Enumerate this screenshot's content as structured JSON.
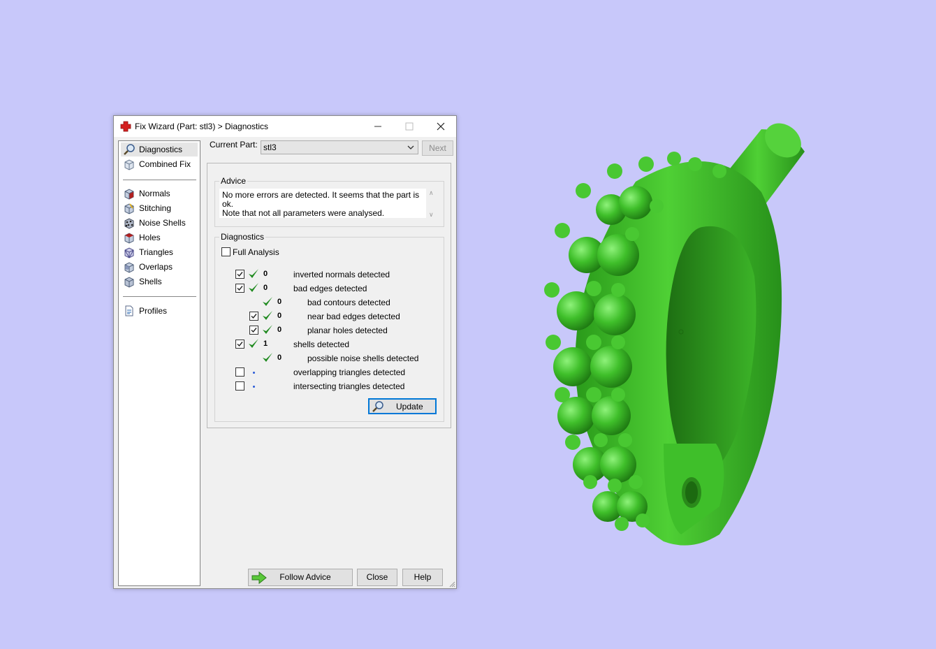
{
  "window": {
    "title": "Fix Wizard (Part: stl3) > Diagnostics",
    "minimize_glyph": "—",
    "maximize_glyph": "☐",
    "close_glyph": "✕"
  },
  "sidebar": {
    "top_items": [
      {
        "label": "Diagnostics",
        "icon": "magnifier-icon",
        "selected": true
      },
      {
        "label": "Combined Fix",
        "icon": "cube-icon"
      }
    ],
    "fix_items": [
      {
        "label": "Normals",
        "icon": "normals-cube-icon"
      },
      {
        "label": "Stitching",
        "icon": "stitching-cube-icon"
      },
      {
        "label": "Noise Shells",
        "icon": "noise-shells-icon"
      },
      {
        "label": "Holes",
        "icon": "holes-cube-icon"
      },
      {
        "label": "Triangles",
        "icon": "triangles-cube-icon"
      },
      {
        "label": "Overlaps",
        "icon": "overlaps-cube-icon"
      },
      {
        "label": "Shells",
        "icon": "shells-cube-icon"
      }
    ],
    "bottom_items": [
      {
        "label": "Profiles",
        "icon": "document-icon"
      }
    ]
  },
  "part": {
    "label": "Current Part:",
    "value": "stl3",
    "next_label": "Next"
  },
  "advice": {
    "title": "Advice",
    "line1": "No more errors are detected. It seems that the part is ok.",
    "line2": "Note that not all parameters were analysed."
  },
  "diagnostics": {
    "title": "Diagnostics",
    "full_analysis_label": "Full Analysis",
    "full_analysis_checked": false,
    "rows": [
      {
        "checkbox": true,
        "checked": true,
        "status": "ok",
        "count": "0",
        "label": "inverted normals detected",
        "indent": 0
      },
      {
        "checkbox": true,
        "checked": true,
        "status": "ok",
        "count": "0",
        "label": "bad edges detected",
        "indent": 0
      },
      {
        "checkbox": false,
        "checked": false,
        "status": "ok",
        "count": "0",
        "label": "bad contours detected",
        "indent": 1
      },
      {
        "checkbox": true,
        "checked": true,
        "status": "ok",
        "count": "0",
        "label": "near bad edges detected",
        "indent": 1
      },
      {
        "checkbox": true,
        "checked": true,
        "status": "ok",
        "count": "0",
        "label": "planar holes detected",
        "indent": 1
      },
      {
        "checkbox": true,
        "checked": true,
        "status": "ok",
        "count": "1",
        "label": "shells detected",
        "indent": 0
      },
      {
        "checkbox": false,
        "checked": false,
        "status": "ok",
        "count": "0",
        "label": "possible noise shells detected",
        "indent": 1
      },
      {
        "checkbox": true,
        "checked": false,
        "status": "pending",
        "count": "",
        "label": "overlapping triangles detected",
        "indent": 0
      },
      {
        "checkbox": true,
        "checked": false,
        "status": "pending",
        "count": "",
        "label": "intersecting triangles detected",
        "indent": 0
      }
    ],
    "update_label": "Update"
  },
  "footer": {
    "follow_advice_label": "Follow Advice",
    "close_label": "Close",
    "help_label": "Help"
  },
  "colors": {
    "background": "#c8c8fa",
    "model_green": "#3fbf2a",
    "check_green": "#1f8a1f",
    "accent_blue": "#0078d7",
    "app_icon_red": "#d42020"
  }
}
